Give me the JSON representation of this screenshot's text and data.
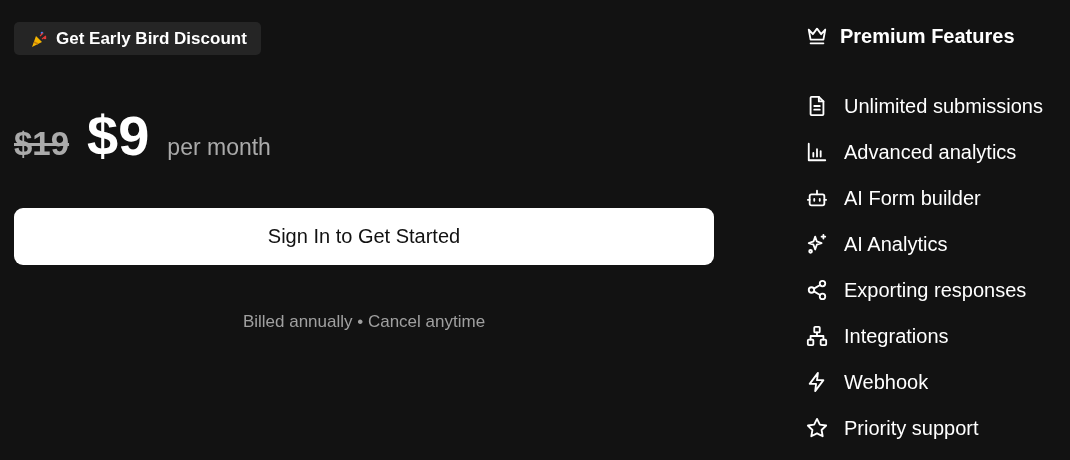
{
  "badge": {
    "label": "Get Early Bird Discount"
  },
  "price": {
    "old": "$19",
    "current": "$9",
    "period": "per month"
  },
  "cta": {
    "label": "Sign In to Get Started"
  },
  "note": "Billed annually • Cancel anytime",
  "features_title": "Premium Features",
  "features": [
    {
      "kind": "document",
      "label": "Unlimited submissions"
    },
    {
      "kind": "chart",
      "label": "Advanced analytics"
    },
    {
      "kind": "robot",
      "label": "AI Form builder"
    },
    {
      "kind": "sparkles",
      "label": "AI Analytics"
    },
    {
      "kind": "share",
      "label": "Exporting responses"
    },
    {
      "kind": "hierarchy",
      "label": "Integrations"
    },
    {
      "kind": "bolt",
      "label": "Webhook"
    },
    {
      "kind": "star",
      "label": "Priority support"
    }
  ]
}
